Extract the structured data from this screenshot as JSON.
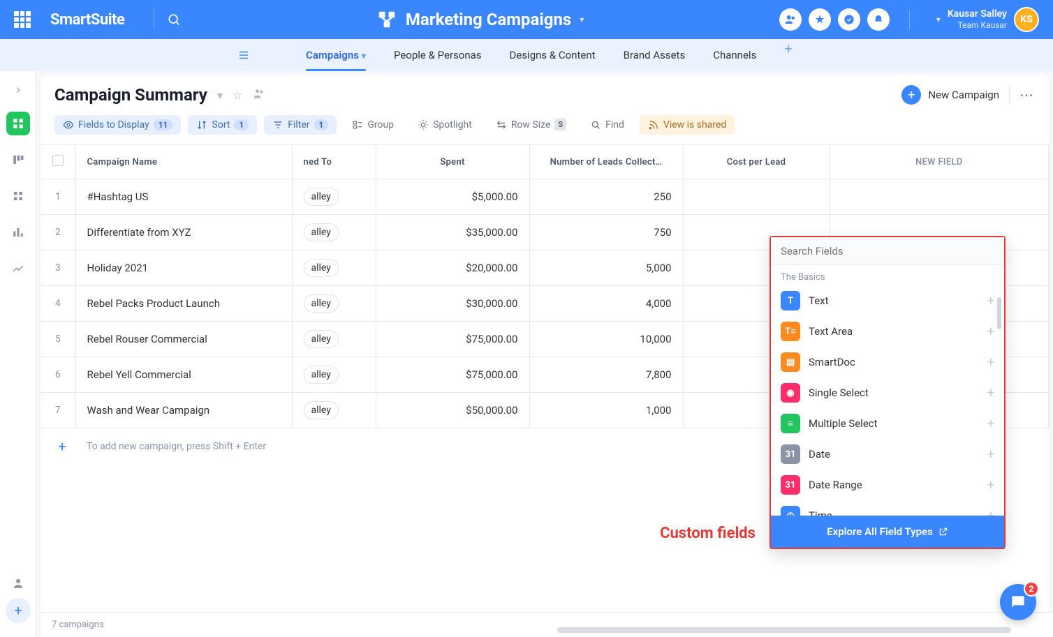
{
  "header": {
    "brand": "SmartSuite",
    "title": "Marketing Campaigns",
    "user_name": "Kausar Salley",
    "user_team": "Team Kausar",
    "avatar_initials": "KS"
  },
  "subnav": {
    "items": [
      {
        "label": "Campaigns",
        "active": true,
        "dropdown": true
      },
      {
        "label": "People & Personas"
      },
      {
        "label": "Designs & Content"
      },
      {
        "label": "Brand Assets"
      },
      {
        "label": "Channels"
      }
    ]
  },
  "page": {
    "title": "Campaign Summary",
    "new_button": "New Campaign"
  },
  "toolbar": {
    "fields_label": "Fields to Display",
    "fields_count": "11",
    "sort_label": "Sort",
    "sort_count": "1",
    "filter_label": "Filter",
    "filter_count": "1",
    "group_label": "Group",
    "spotlight_label": "Spotlight",
    "rowsize_label": "Row Size",
    "rowsize_badge": "S",
    "find_label": "Find",
    "shared_label": "View is shared"
  },
  "columns": {
    "name": "Campaign Name",
    "assigned": "ned To",
    "spent": "Spent",
    "leads": "Number of Leads Collect…",
    "cost": "Cost per Lead",
    "new": "NEW FIELD"
  },
  "rows": [
    {
      "n": "1",
      "name": "#Hashtag US",
      "assignee": "alley",
      "spent": "$5,000.00",
      "leads": "250"
    },
    {
      "n": "2",
      "name": "Differentiate from XYZ",
      "assignee": "alley",
      "spent": "$35,000.00",
      "leads": "750"
    },
    {
      "n": "3",
      "name": "Holiday 2021",
      "assignee": "alley",
      "spent": "$20,000.00",
      "leads": "5,000"
    },
    {
      "n": "4",
      "name": "Rebel Packs Product Launch",
      "assignee": "alley",
      "spent": "$30,000.00",
      "leads": "4,000"
    },
    {
      "n": "5",
      "name": "Rebel Rouser Commercial",
      "assignee": "alley",
      "spent": "$75,000.00",
      "leads": "10,000"
    },
    {
      "n": "6",
      "name": "Rebel Yell Commercial",
      "assignee": "alley",
      "spent": "$75,000.00",
      "leads": "7,800"
    },
    {
      "n": "7",
      "name": "Wash and Wear Campaign",
      "assignee": "alley",
      "spent": "$50,000.00",
      "leads": "1,000"
    }
  ],
  "add_row_hint": "To add new campaign, press Shift + Enter",
  "footer_count": "7 campaigns",
  "field_popup": {
    "search_placeholder": "Search Fields",
    "section": "The Basics",
    "items": [
      {
        "label": "Text",
        "color": "#3a86ff",
        "glyph": "T"
      },
      {
        "label": "Text Area",
        "color": "#ff8a1f",
        "glyph": "T≡"
      },
      {
        "label": "SmartDoc",
        "color": "#ff8a1f",
        "glyph": "▤"
      },
      {
        "label": "Single Select",
        "color": "#ff2d6c",
        "glyph": "◉"
      },
      {
        "label": "Multiple Select",
        "color": "#22c55e",
        "glyph": "≡"
      },
      {
        "label": "Date",
        "color": "#8a94a6",
        "glyph": "31"
      },
      {
        "label": "Date Range",
        "color": "#ff2d6c",
        "glyph": "31"
      },
      {
        "label": "Time",
        "color": "#3a86ff",
        "glyph": "◷"
      }
    ],
    "footer": "Explore All Field Types"
  },
  "annotation": "Custom fields",
  "chat_badge": "2"
}
